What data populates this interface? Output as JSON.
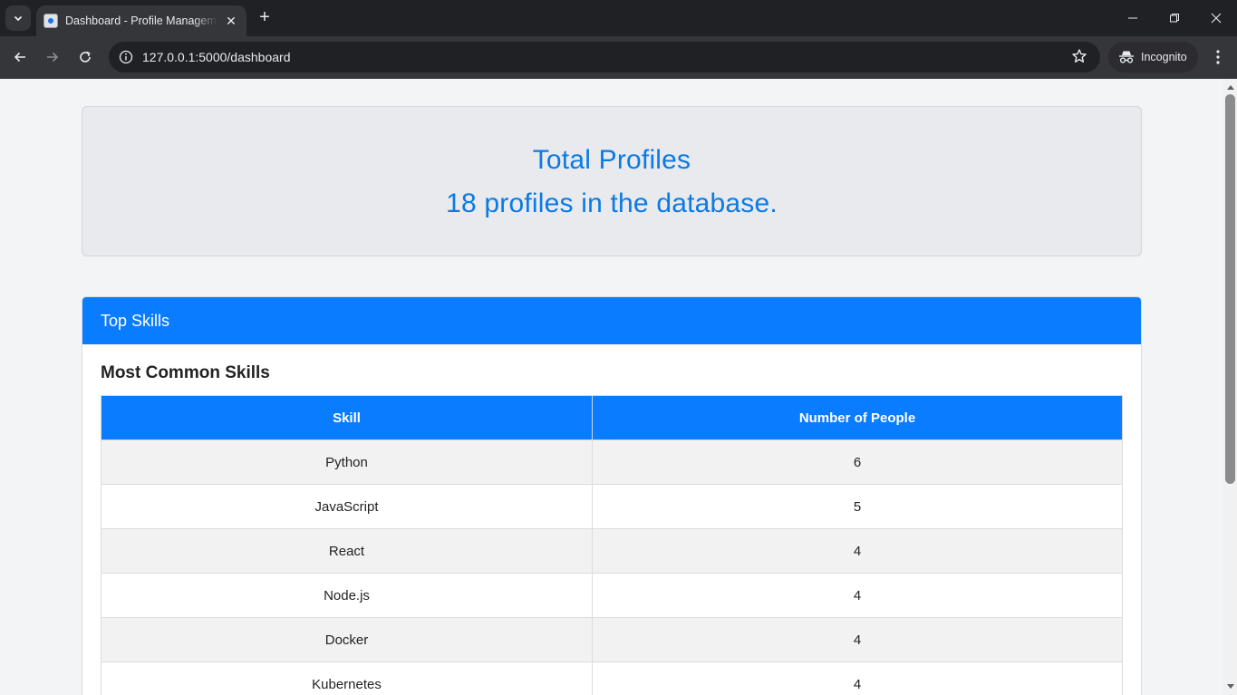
{
  "browser": {
    "tab_title": "Dashboard - Profile Management",
    "url": "127.0.0.1:5000/dashboard",
    "incognito_label": "Incognito"
  },
  "summary": {
    "title": "Total Profiles",
    "text": "18 profiles in the database."
  },
  "skills_card": {
    "header": "Top Skills",
    "subtitle": "Most Common Skills",
    "columns": [
      "Skill",
      "Number of People"
    ],
    "rows": [
      {
        "skill": "Python",
        "count": "6"
      },
      {
        "skill": "JavaScript",
        "count": "5"
      },
      {
        "skill": "React",
        "count": "4"
      },
      {
        "skill": "Node.js",
        "count": "4"
      },
      {
        "skill": "Docker",
        "count": "4"
      },
      {
        "skill": "Kubernetes",
        "count": "4"
      }
    ]
  },
  "colors": {
    "accent": "#0a7cff",
    "summary_text": "#0a7ae6",
    "summary_bg": "#e9eaed",
    "page_bg": "#f3f4f6"
  },
  "icons": [
    "tab-search-icon",
    "favicon-icon",
    "close-icon",
    "plus-icon",
    "minimize-icon",
    "restore-icon",
    "window-close-icon",
    "back-arrow-icon",
    "forward-arrow-icon",
    "reload-icon",
    "site-info-icon",
    "bookmark-star-icon",
    "incognito-icon",
    "more-vertical-icon"
  ]
}
